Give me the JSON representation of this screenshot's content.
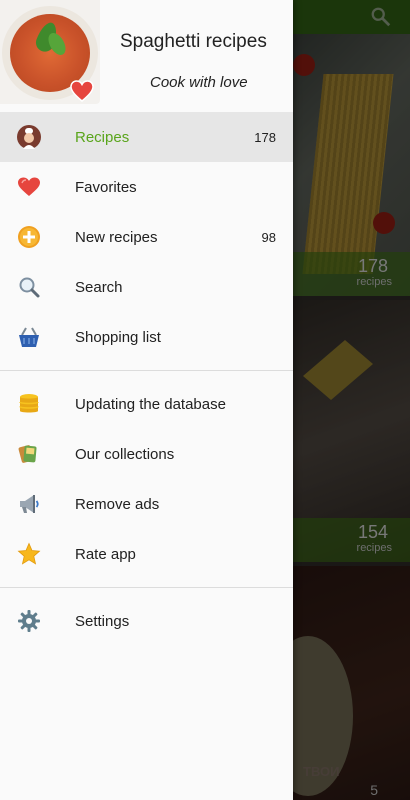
{
  "background": {
    "cards": [
      {
        "count": "178",
        "unit": "recipes"
      },
      {
        "count": "154",
        "unit": "recipes"
      },
      {
        "label": "ТВОИ",
        "count": "5"
      }
    ]
  },
  "drawer": {
    "title": "Spaghetti recipes",
    "subtitle": "Cook with love",
    "items": [
      {
        "label": "Recipes",
        "count": "178",
        "icon": "chef-icon",
        "active": true
      },
      {
        "label": "Favorites",
        "count": "",
        "icon": "heart-icon"
      },
      {
        "label": "New recipes",
        "count": "98",
        "icon": "plus-icon"
      },
      {
        "label": "Search",
        "count": "",
        "icon": "search-icon"
      },
      {
        "label": "Shopping list",
        "count": "",
        "icon": "basket-icon"
      }
    ],
    "items2": [
      {
        "label": "Updating the database",
        "icon": "database-icon"
      },
      {
        "label": "Our collections",
        "icon": "collections-icon"
      },
      {
        "label": "Remove ads",
        "icon": "megaphone-icon"
      },
      {
        "label": "Rate app",
        "icon": "star-icon"
      }
    ],
    "items3": [
      {
        "label": "Settings",
        "icon": "gear-icon"
      }
    ]
  },
  "colors": {
    "accent": "#5aa51c",
    "topbar": "#2f5e13"
  }
}
